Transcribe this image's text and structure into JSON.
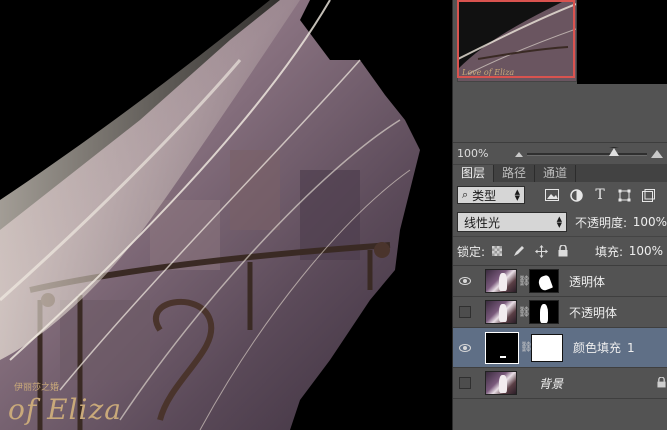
{
  "canvas": {
    "caption_small": "伊丽莎之婚",
    "caption_large": "of Eliza",
    "thumb_caption": "Love of Eliza"
  },
  "navigator": {
    "zoom": "100%",
    "icons": [
      "zoom-out-mountain-icon",
      "zoom-in-mountain-icon"
    ]
  },
  "tabs": [
    {
      "label": "图层",
      "active": true
    },
    {
      "label": "路径",
      "active": false
    },
    {
      "label": "通道",
      "active": false
    }
  ],
  "filter": {
    "kind": "类型",
    "icons": [
      "image-filter-icon",
      "adjustment-filter-icon",
      "type-filter-icon",
      "shape-filter-icon",
      "smart-object-filter-icon"
    ]
  },
  "blend": {
    "mode": "线性光",
    "opacity_label": "不透明度:",
    "opacity": "100%"
  },
  "lock": {
    "label": "锁定:",
    "icons": [
      "lock-transparent-icon",
      "lock-pixels-icon",
      "lock-position-icon",
      "lock-all-icon"
    ],
    "fill_label": "填充:",
    "fill": "100%"
  },
  "layers": [
    {
      "name": "透明体",
      "visible": true,
      "thumb": "photo",
      "mask": "white-shape",
      "selected": false
    },
    {
      "name": "不透明体",
      "visible": false,
      "thumb": "photo",
      "mask": "figure",
      "selected": false
    },
    {
      "name": "颜色填充",
      "index": "1",
      "visible": true,
      "thumb": "black",
      "mask": "full-white",
      "selected": true
    },
    {
      "name": "背景",
      "visible": false,
      "thumb": "photo",
      "mask": null,
      "selected": false,
      "locked": true
    }
  ],
  "colors": {
    "panel_bg": "#535353",
    "selected_layer": "#5f6f86",
    "navigator_box": "#d9534f"
  }
}
